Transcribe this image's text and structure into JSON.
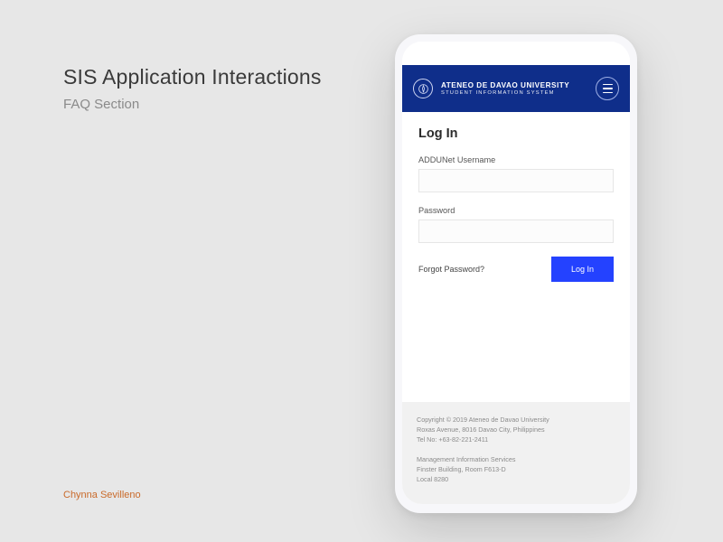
{
  "presentation": {
    "title": "SIS Application Interactions",
    "subtitle": "FAQ Section",
    "credit": "Chynna Sevilleno"
  },
  "app": {
    "brand_line1": "ATENEO DE DAVAO UNIVERSITY",
    "brand_line2": "STUDENT INFORMATION SYSTEM",
    "colors": {
      "header": "#0f2e8a",
      "primary_button": "#2442ff"
    }
  },
  "login": {
    "heading": "Log In",
    "username_label": "ADDUNet Username",
    "username_value": "",
    "password_label": "Password",
    "password_value": "",
    "forgot_label": "Forgot Password?",
    "submit_label": "Log In"
  },
  "footer": {
    "copyright": "Copyright © 2019 Ateneo de Davao University",
    "address": "Roxas Avenue, 8016 Davao City, Philippines",
    "tel": "Tel No: +63-82-221-2411",
    "dept": "Management Information Services",
    "room": "Finster Building, Room F613-D",
    "local": "Local 8280"
  }
}
